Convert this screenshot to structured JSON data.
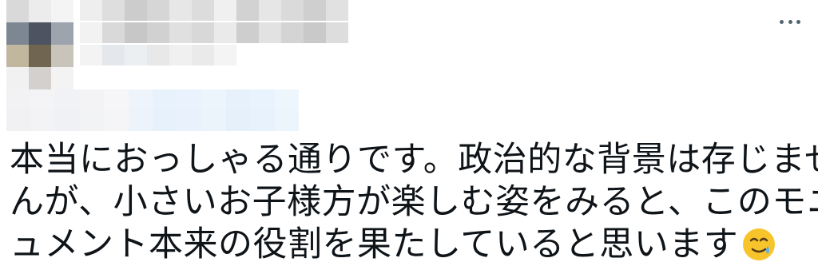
{
  "tweet": {
    "text_lines": [
      "本当におっしゃる通りです。政治的な背景は存じませ",
      "んが、小さいお子様方が楽しむ姿をみると、このモニ",
      "ュメント本来の役割を果たしていると思います"
    ],
    "trailing_emoji": "face-holding-back-tears-icon"
  },
  "colors": {
    "text": "#0f1419",
    "icon_gray": "#536471",
    "emoji_face": "#f7c52b",
    "emoji_tear": "#5ab0f0"
  }
}
